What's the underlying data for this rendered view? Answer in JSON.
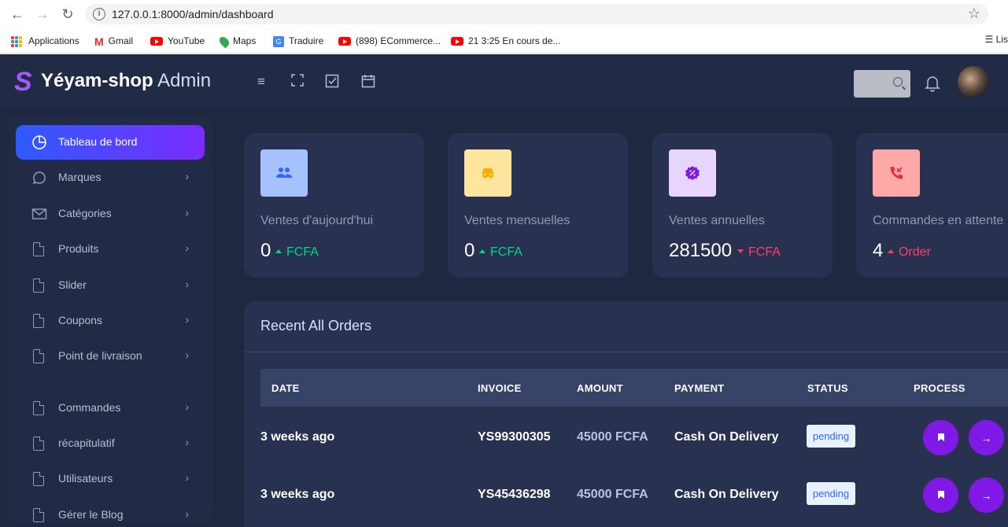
{
  "browser": {
    "url": "127.0.0.1:8000/admin/dashboard",
    "bookmarks": [
      "Applications",
      "Gmail",
      "YouTube",
      "Maps",
      "Traduire",
      "(898) ECommerce...",
      "21 3:25 En cours de..."
    ],
    "reading_list": "Lis"
  },
  "brand": {
    "name": "Yéyam-shop",
    "suffix": "Admin"
  },
  "sidebar": {
    "items": [
      {
        "label": "Tableau de bord",
        "icon": "pie-chart-icon"
      },
      {
        "label": "Marques",
        "icon": "message-circle-icon"
      },
      {
        "label": "Catégories",
        "icon": "email-icon"
      },
      {
        "label": "Produits",
        "icon": "file-icon"
      },
      {
        "label": "Slider",
        "icon": "file-icon"
      },
      {
        "label": "Coupons",
        "icon": "file-icon"
      },
      {
        "label": "Point de livraison",
        "icon": "file-icon"
      },
      {
        "label": "Commandes",
        "icon": "file-icon"
      },
      {
        "label": "récapitulatif",
        "icon": "file-icon"
      },
      {
        "label": "Utilisateurs",
        "icon": "file-icon"
      },
      {
        "label": "Gérer le Blog",
        "icon": "file-icon"
      }
    ]
  },
  "stats": [
    {
      "label": "Ventes d'aujourd'hui",
      "value": "0",
      "unit": "FCFA",
      "trend": "up",
      "icon": "users-icon",
      "icon_bg": "#a6c1ff",
      "icon_color": "#3366ff"
    },
    {
      "label": "Ventes mensuelles",
      "value": "0",
      "unit": "FCFA",
      "trend": "up",
      "icon": "car-icon",
      "icon_bg": "#ffe59e",
      "icon_color": "#ffaa00"
    },
    {
      "label": "Ventes annuelles",
      "value": "281500",
      "unit": "FCFA",
      "trend": "down",
      "icon": "discount-icon",
      "icon_bg": "#e6d5ff",
      "icon_color": "#7f19e6"
    },
    {
      "label": "Commandes en attente",
      "value": "4",
      "unit": "Order",
      "trend": "up-red",
      "icon": "phone-missed-icon",
      "icon_bg": "#ffa8a8",
      "icon_color": "#e02d4b"
    }
  ],
  "orders": {
    "title": "Recent All Orders",
    "columns": [
      "DATE",
      "INVOICE",
      "AMOUNT",
      "PAYMENT",
      "STATUS",
      "PROCESS"
    ],
    "rows": [
      {
        "date": "3 weeks ago",
        "invoice": "YS99300305",
        "amount": "45000 FCFA",
        "payment": "Cash On Delivery",
        "status": "pending"
      },
      {
        "date": "3 weeks ago",
        "invoice": "YS45436298",
        "amount": "45000 FCFA",
        "payment": "Cash On Delivery",
        "status": "pending"
      }
    ]
  }
}
